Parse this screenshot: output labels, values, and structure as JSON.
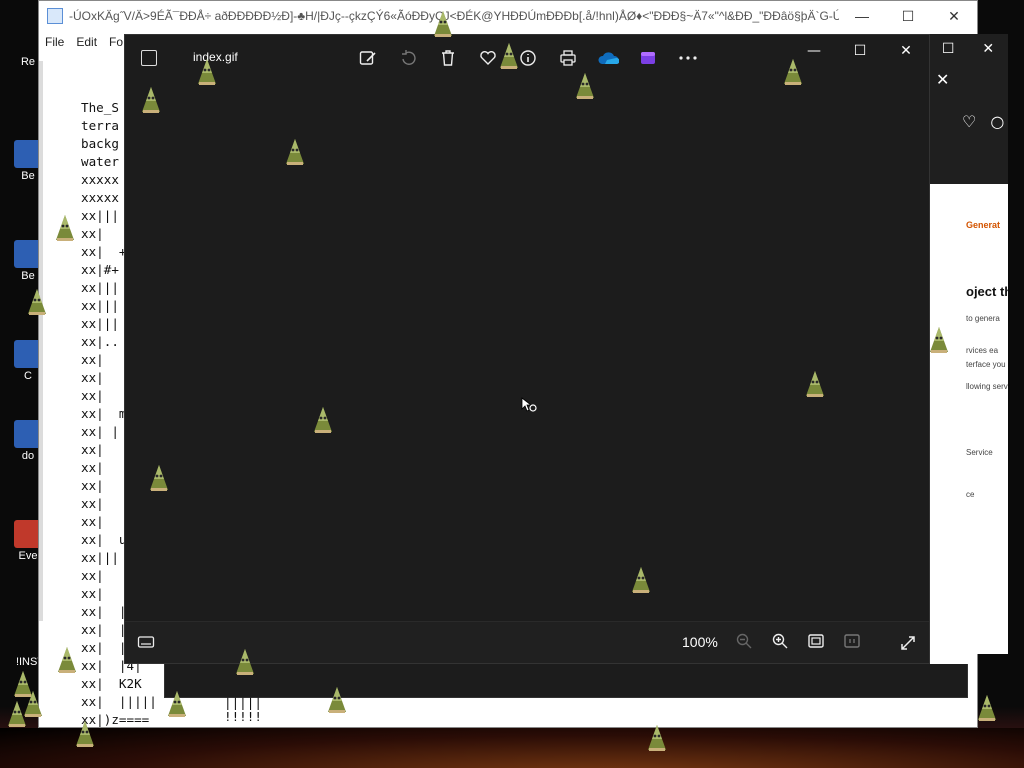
{
  "desktop": {
    "icons": [
      {
        "label": "Re"
      },
      {
        "label": "Be"
      },
      {
        "label": "Be"
      },
      {
        "label": "C"
      },
      {
        "label": "do"
      },
      {
        "label": "Eve"
      },
      {
        "label": "!INST"
      }
    ]
  },
  "notepad": {
    "title": "-ÚOxKÄg˝V/Ä>9ÉÃ¯ÐÐÅ÷ aðÐÐÐÐÐ½Ð]-♣H/|ÐJç--çkzÇÝ6«ÃóÐÐyÇJ<ÐÉK@YHÐÐÚmÐÐÐb[.å/!hnl)ÅØ♦<\"ÐÐÐ§~Ä7«\"^l&ÐÐ_\"ÐÐâö§þÄ`G-Úø\"É...",
    "controls": {
      "minimize": "—",
      "maximize": "☐",
      "close": "✕"
    },
    "menu": [
      "File",
      "Edit",
      "Fo"
    ],
    "lines": [
      "The_S",
      "terra",
      "backg",
      "water",
      "xxxxx",
      "xxxxx",
      "xx|||",
      "xx|",
      "xx|  +",
      "xx|#+",
      "xx|||",
      "xx|||",
      "xx|||",
      "xx|..",
      "xx|",
      "xx|",
      "xx|",
      "xx|  m",
      "xx| |",
      "xx|",
      "xx|",
      "xx|",
      "xx|",
      "xx|",
      "xx|  u",
      "xx|||",
      "xx|",
      "xx|",
      "xx|  |",
      "xx|  |",
      "xx|  |",
      "xx|  |4|",
      "xx|  K2K",
      "xx|  |||||",
      "xx|)z===="
    ],
    "under_lines": [
      "|||||",
      "!!!!!"
    ]
  },
  "photos": {
    "filename": "index.gif",
    "zoom": "100%",
    "toolbar": [
      {
        "name": "edit-image-icon"
      },
      {
        "name": "rotate-icon"
      },
      {
        "name": "delete-icon"
      },
      {
        "name": "favorite-heart-icon"
      },
      {
        "name": "info-icon"
      },
      {
        "name": "print-icon"
      },
      {
        "name": "onedrive-cloud-icon"
      },
      {
        "name": "clipchamp-icon"
      },
      {
        "name": "more-options-icon"
      }
    ],
    "controls": {
      "minimize": "—",
      "maximize": "☐",
      "close": "✕"
    }
  },
  "browser": {
    "tab_label": "Generat",
    "heading": "oject th",
    "lines": [
      "to genera",
      "rvices ea",
      "terface you",
      "llowing serv",
      "Service",
      "ce"
    ]
  },
  "colors": {
    "photos_bg": "#1c1c1c",
    "photos_bar": "#202020",
    "onedrive_blue": "#0f6cbd",
    "clipchamp_purple": "#7b3fe4",
    "browser_accent": "#d35400"
  }
}
